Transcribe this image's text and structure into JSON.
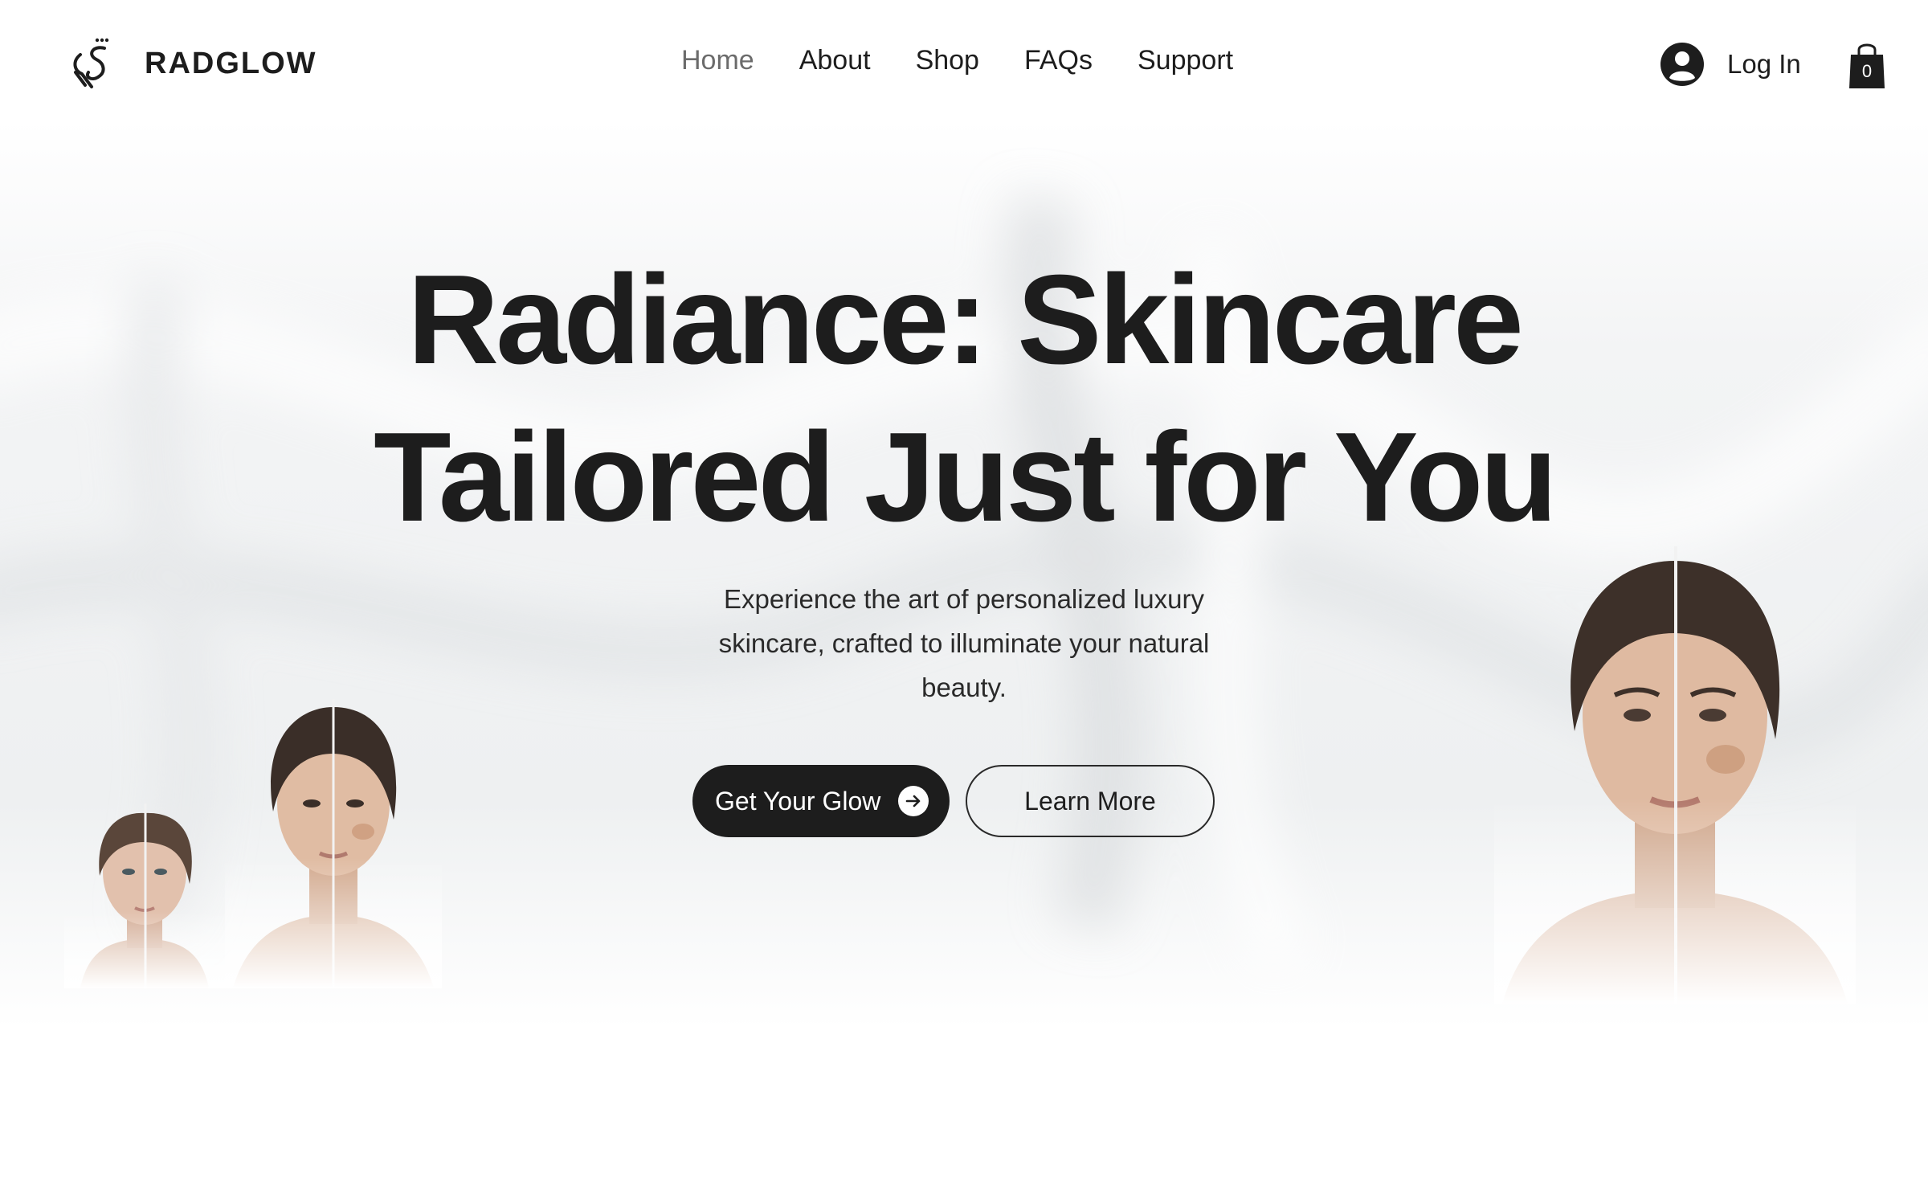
{
  "brand": {
    "name": "RADGLOW",
    "logo_icon": "radglow-monogram-icon"
  },
  "nav": {
    "items": [
      {
        "label": "Home",
        "active": true
      },
      {
        "label": "About",
        "active": false
      },
      {
        "label": "Shop",
        "active": false
      },
      {
        "label": "FAQs",
        "active": false
      },
      {
        "label": "Support",
        "active": false
      }
    ]
  },
  "account": {
    "login_label": "Log In",
    "avatar_icon": "user-avatar-icon"
  },
  "cart": {
    "count": "0",
    "icon": "shopping-bag-icon"
  },
  "hero": {
    "title_line1": "Radiance: Skincare",
    "title_line2": "Tailored Just for You",
    "subtitle": "Experience the art of personalized luxury skincare, crafted to illuminate your natural beauty.",
    "primary_cta": "Get Your Glow",
    "primary_cta_icon": "arrow-right-circle-icon",
    "secondary_cta": "Learn More"
  },
  "colors": {
    "text": "#1d1d1d",
    "nav_active": "#6b6b6b",
    "button_dark": "#1d1d1d",
    "background": "#ffffff"
  }
}
